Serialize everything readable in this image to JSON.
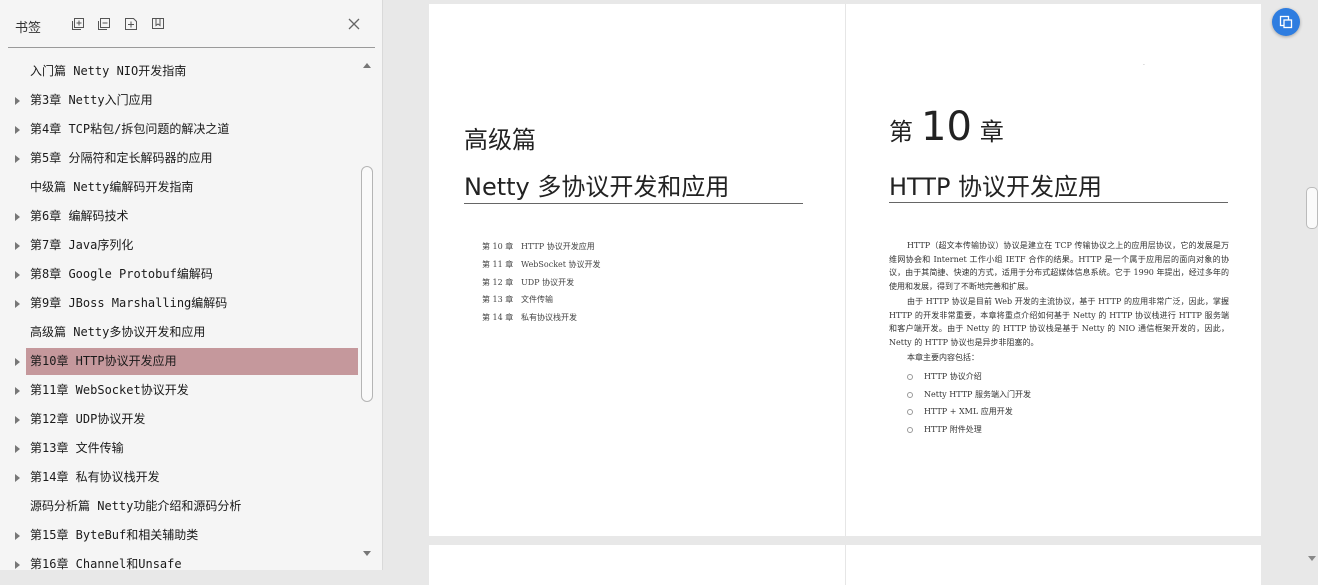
{
  "sidebar": {
    "title": "书签",
    "tools": [
      {
        "icon": "expand-all-icon"
      },
      {
        "icon": "collapse-all-icon"
      },
      {
        "icon": "add-bookmark-icon"
      },
      {
        "icon": "bookmark-icon"
      }
    ],
    "close_icon": "close-icon",
    "items": [
      {
        "label": "入门篇 Netty NIO开发指南",
        "caret": false
      },
      {
        "label": "第3章 Netty入门应用",
        "caret": true
      },
      {
        "label": "第4章 TCP粘包/拆包问题的解决之道",
        "caret": true
      },
      {
        "label": "第5章 分隔符和定长解码器的应用",
        "caret": true
      },
      {
        "label": "中级篇 Netty编解码开发指南",
        "caret": false
      },
      {
        "label": "第6章 编解码技术",
        "caret": true
      },
      {
        "label": "第7章 Java序列化",
        "caret": true
      },
      {
        "label": "第8章 Google Protobuf编解码",
        "caret": true
      },
      {
        "label": "第9章 JBoss Marshalling编解码",
        "caret": true
      },
      {
        "label": "高级篇 Netty多协议开发和应用",
        "caret": false
      },
      {
        "label": "第10章 HTTP协议开发应用",
        "caret": true,
        "selected": true
      },
      {
        "label": "第11章 WebSocket协议开发",
        "caret": true
      },
      {
        "label": "第12章 UDP协议开发",
        "caret": true
      },
      {
        "label": "第13章 文件传输",
        "caret": true
      },
      {
        "label": "第14章 私有协议栈开发",
        "caret": true
      },
      {
        "label": "源码分析篇 Netty功能介绍和源码分析",
        "caret": false
      },
      {
        "label": "第15章 ByteBuf和相关辅助类",
        "caret": true
      },
      {
        "label": "第16章 Channel和Unsafe",
        "caret": true
      }
    ],
    "selected_color": "#c5989c"
  },
  "left_page": {
    "part_label": "高级篇",
    "part_title": "Netty 多协议开发和应用",
    "toc": [
      {
        "chapter": "第 10 章",
        "title": "HTTP 协议开发应用"
      },
      {
        "chapter": "第 11 章",
        "title": "WebSocket 协议开发"
      },
      {
        "chapter": "第 12 章",
        "title": "UDP 协议开发"
      },
      {
        "chapter": "第 13 章",
        "title": "文件传输"
      },
      {
        "chapter": "第 14 章",
        "title": "私有协议栈开发"
      }
    ]
  },
  "right_page": {
    "chapter_prefix": "第",
    "chapter_number": "10",
    "chapter_suffix": "章",
    "chapter_title": "HTTP 协议开发应用",
    "paragraphs": [
      "HTTP（超文本传输协议）协议是建立在 TCP 传输协议之上的应用层协议，它的发展是万维网协会和 Internet 工作小组 IETF 合作的结果。HTTP 是一个属于应用层的面向对象的协议，由于其简捷、快速的方式，适用于分布式超媒体信息系统。它于 1990 年提出，经过多年的使用和发展，得到了不断地完善和扩展。",
      "由于 HTTP 协议是目前 Web 开发的主流协议，基于 HTTP 的应用非常广泛，因此，掌握 HTTP 的开发非常重要，本章将重点介绍如何基于 Netty 的 HTTP 协议栈进行 HTTP 服务端和客户端开发。由于 Netty 的 HTTP 协议栈是基于 Netty 的 NIO 通信框架开发的，因此，Netty 的 HTTP 协议也是异步非阻塞的。"
    ],
    "intro": "本章主要内容包括：",
    "bullets": [
      "HTTP 协议介绍",
      "Netty HTTP 服务端入门开发",
      "HTTP + XML 应用开发",
      "HTTP 附件处理"
    ]
  },
  "float_button": {
    "icon": "page-view-icon",
    "color": "#2e7de0"
  }
}
